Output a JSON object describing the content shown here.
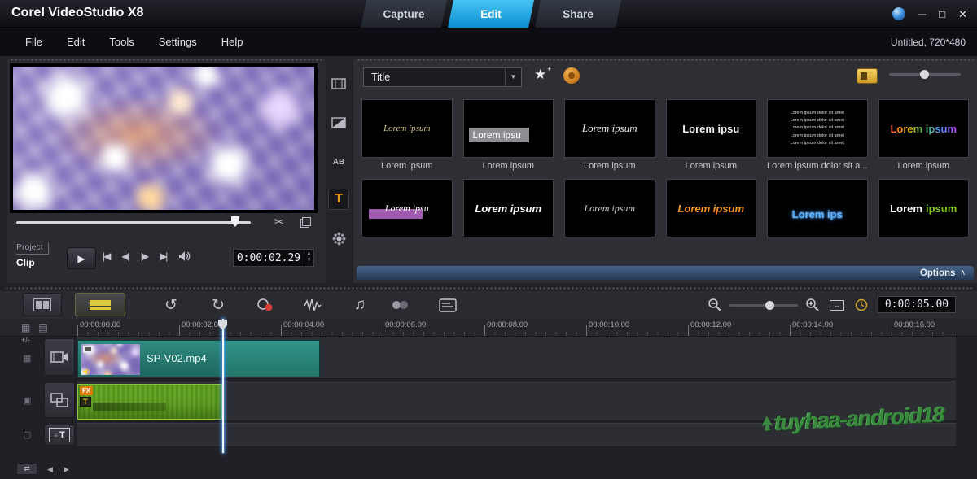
{
  "titlebar": {
    "app_title": "Corel VideoStudio X8",
    "tabs": [
      {
        "label": "Capture"
      },
      {
        "label": "Edit"
      },
      {
        "label": "Share"
      }
    ],
    "window_controls": {
      "minimize": "─",
      "maximize": "□",
      "close": "✕"
    }
  },
  "menubar": {
    "items": [
      "File",
      "Edit",
      "Tools",
      "Settings",
      "Help"
    ],
    "project_info": "Untitled, 720*480"
  },
  "preview": {
    "project_label": "Project",
    "clip_label": "Clip",
    "timecode": "0:00:02.29"
  },
  "tools": {
    "ab_icon": "AB",
    "title_icon": "T"
  },
  "library": {
    "category_selected": "Title",
    "options_label": "Options",
    "items": [
      {
        "preview": "Lorem ipsum",
        "caption": "Lorem ipsum"
      },
      {
        "preview": "Lorem ipsu",
        "caption": "Lorem ipsum"
      },
      {
        "preview": "Lorem ipsum",
        "caption": "Lorem ipsum"
      },
      {
        "preview": "Lorem ipsu",
        "caption": "Lorem ipsum"
      },
      {
        "preview": "Lorem ipsum dolor sit amet\nLorem ipsum dolor sit amet\nLorem ipsum dolor sit amet\nLorem ipsum dolor sit amet\nLorem ipsum dolor sit amet",
        "caption": "Lorem ipsum dolor sit a..."
      },
      {
        "preview": "Lorem ipsum",
        "caption": "Lorem ipsum"
      },
      {
        "preview": "Lorem ipsu",
        "caption": ""
      },
      {
        "preview": "Lorem ipsum",
        "caption": ""
      },
      {
        "preview": "Lorem ipsum",
        "caption": ""
      },
      {
        "preview": "Lorem ipsum",
        "caption": ""
      },
      {
        "preview": "Lorem ips",
        "caption": ""
      },
      {
        "word1": "Lorem",
        "word2": "ipsum",
        "caption": ""
      }
    ]
  },
  "timeline": {
    "timecode": "0:00:05.00",
    "ruler_labels": [
      "00:00:00.00",
      "00:00:02.00",
      "00:00:04.00",
      "00:00:06.00",
      "00:00:08.00",
      "00:00:10.00",
      "00:00:12.00",
      "00:00:14.00",
      "00:00:16.00"
    ],
    "video_clip": {
      "name": "SP-V02.mp4"
    },
    "title_clip": {
      "fx_badge": "FX",
      "t_badge": "T"
    },
    "track_title_icon": "T",
    "watermark": "tuyhaa-android18",
    "plus_minus": "+/-"
  },
  "icons": {
    "dropdown_arrow": "▼",
    "star": "★",
    "star_plus": "+",
    "play": "▶",
    "prev": "|◀",
    "frame_back": "◀|",
    "frame_fwd": "|▶",
    "next": "▶|",
    "scissors": "✂",
    "undo": "↺",
    "redo": "↻",
    "music": "♫",
    "options_chevron": "∧",
    "spin_up": "▲",
    "spin_down": "▼",
    "scroll_left": "◀",
    "scroll_right": "▶",
    "fit_arrows": "↔",
    "pan": "⇄",
    "grid_a": "▦",
    "grid_b": "▤",
    "rail_video": "▦",
    "rail_overlay": "▣",
    "rail_title": "▢"
  },
  "colors": {
    "accent_blue": "#1ea7e0",
    "clip_teal": "#2a8078",
    "clip_green": "#5f9e23",
    "title_tool_orange": "#e8941e",
    "watermark_green": "#3c9440"
  }
}
